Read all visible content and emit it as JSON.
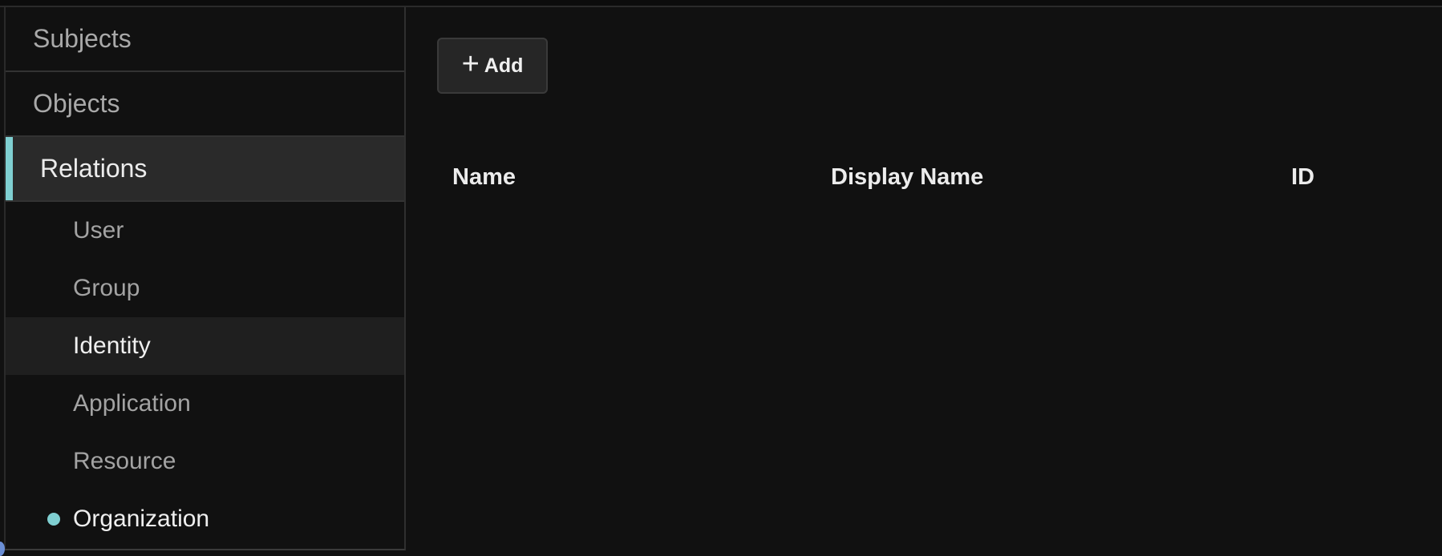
{
  "sidebar": {
    "sections": [
      {
        "label": "Subjects"
      },
      {
        "label": "Objects"
      },
      {
        "label": "Relations",
        "active": true
      }
    ],
    "relation_items": [
      {
        "label": "User"
      },
      {
        "label": "Group"
      },
      {
        "label": "Identity",
        "hovered": true
      },
      {
        "label": "Application"
      },
      {
        "label": "Resource"
      },
      {
        "label": "Organization",
        "selected": true
      }
    ]
  },
  "toolbar": {
    "add_label": "Add",
    "add_icon": "plus-icon"
  },
  "table": {
    "columns": [
      "Name",
      "Display Name",
      "ID"
    ],
    "rows": []
  },
  "colors": {
    "accent": "#7fcfd1",
    "background": "#111111",
    "active_row": "#2a2a2a"
  }
}
